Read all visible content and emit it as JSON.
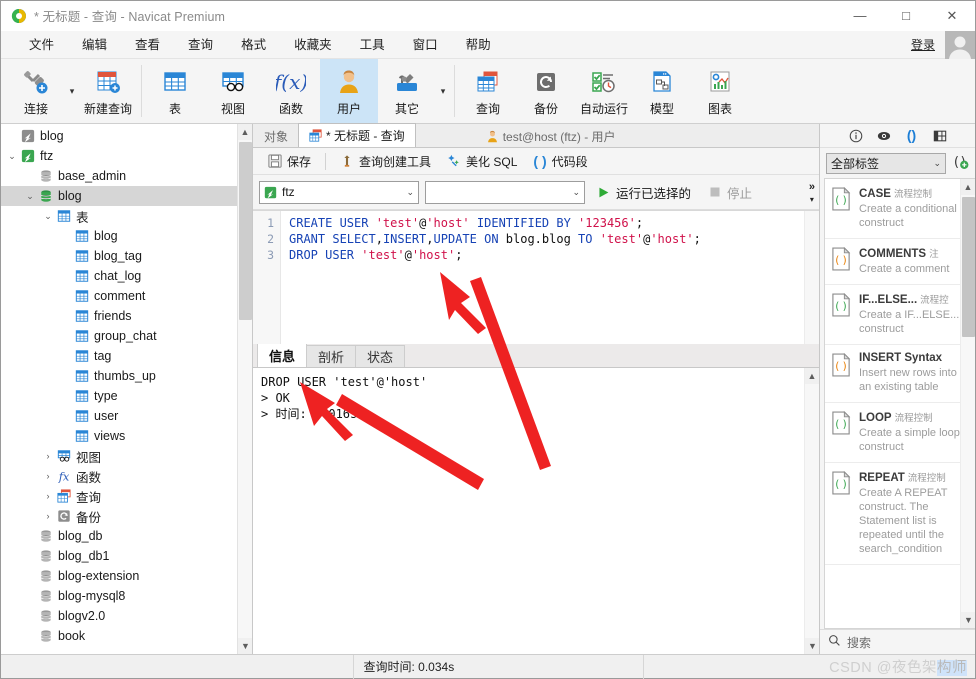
{
  "window": {
    "title_prefix": "* 无标题",
    "title_middle": "查询",
    "title_app": "Navicat Premium",
    "title_full": "* 无标题 - 查询 - Navicat Premium",
    "minimize": "—",
    "maximize": "□",
    "close": "✕"
  },
  "menubar": {
    "items": [
      {
        "label": "文件"
      },
      {
        "label": "编辑"
      },
      {
        "label": "查看"
      },
      {
        "label": "查询"
      },
      {
        "label": "格式"
      },
      {
        "label": "收藏夹"
      },
      {
        "label": "工具"
      },
      {
        "label": "窗口"
      },
      {
        "label": "帮助"
      }
    ],
    "login_label": "登录"
  },
  "ribbon": {
    "items": [
      {
        "label": "连接",
        "icon": "connection-icon",
        "has_caret": true,
        "active": false
      },
      {
        "label": "新建查询",
        "icon": "new-query-icon",
        "has_caret": false,
        "active": false
      },
      {
        "label": "表",
        "icon": "table-icon",
        "has_caret": false,
        "active": false
      },
      {
        "label": "视图",
        "icon": "view-icon",
        "has_caret": false,
        "active": false
      },
      {
        "label": "函数",
        "icon": "function-icon",
        "has_caret": false,
        "active": false
      },
      {
        "label": "用户",
        "icon": "user-icon",
        "has_caret": false,
        "active": true
      },
      {
        "label": "其它",
        "icon": "others-icon",
        "has_caret": true,
        "active": false
      },
      {
        "label": "查询",
        "icon": "query-icon",
        "has_caret": false,
        "active": false
      },
      {
        "label": "备份",
        "icon": "backup-icon",
        "has_caret": false,
        "active": false
      },
      {
        "label": "自动运行",
        "icon": "automation-icon",
        "has_caret": false,
        "active": false
      },
      {
        "label": "模型",
        "icon": "model-icon",
        "has_caret": false,
        "active": false
      },
      {
        "label": "图表",
        "icon": "chart-icon",
        "has_caret": false,
        "active": false
      }
    ]
  },
  "tree": {
    "nodes": [
      {
        "label": "blog",
        "depth": 0,
        "icon": "connection-gray-icon",
        "twist": "",
        "selected": false
      },
      {
        "label": "ftz",
        "depth": 0,
        "icon": "connection-green-icon",
        "twist": "expanded",
        "selected": false
      },
      {
        "label": "base_admin",
        "depth": 1,
        "icon": "database-gray-icon",
        "twist": "",
        "selected": false
      },
      {
        "label": "blog",
        "depth": 1,
        "icon": "database-green-icon",
        "twist": "expanded",
        "selected": true
      },
      {
        "label": "表",
        "depth": 2,
        "icon": "tables-folder-icon",
        "twist": "expanded",
        "selected": false
      },
      {
        "label": "blog",
        "depth": 3,
        "icon": "table-item-icon",
        "twist": "",
        "selected": false
      },
      {
        "label": "blog_tag",
        "depth": 3,
        "icon": "table-item-icon",
        "twist": "",
        "selected": false
      },
      {
        "label": "chat_log",
        "depth": 3,
        "icon": "table-item-icon",
        "twist": "",
        "selected": false
      },
      {
        "label": "comment",
        "depth": 3,
        "icon": "table-item-icon",
        "twist": "",
        "selected": false
      },
      {
        "label": "friends",
        "depth": 3,
        "icon": "table-item-icon",
        "twist": "",
        "selected": false
      },
      {
        "label": "group_chat",
        "depth": 3,
        "icon": "table-item-icon",
        "twist": "",
        "selected": false
      },
      {
        "label": "tag",
        "depth": 3,
        "icon": "table-item-icon",
        "twist": "",
        "selected": false
      },
      {
        "label": "thumbs_up",
        "depth": 3,
        "icon": "table-item-icon",
        "twist": "",
        "selected": false
      },
      {
        "label": "type",
        "depth": 3,
        "icon": "table-item-icon",
        "twist": "",
        "selected": false
      },
      {
        "label": "user",
        "depth": 3,
        "icon": "table-item-icon",
        "twist": "",
        "selected": false
      },
      {
        "label": "views",
        "depth": 3,
        "icon": "table-item-icon",
        "twist": "",
        "selected": false
      },
      {
        "label": "视图",
        "depth": 2,
        "icon": "views-folder-icon",
        "twist": "collapsed",
        "selected": false
      },
      {
        "label": "函数",
        "depth": 2,
        "icon": "functions-folder-icon",
        "twist": "collapsed",
        "selected": false
      },
      {
        "label": "查询",
        "depth": 2,
        "icon": "queries-folder-icon",
        "twist": "collapsed",
        "selected": false
      },
      {
        "label": "备份",
        "depth": 2,
        "icon": "backups-folder-icon",
        "twist": "collapsed",
        "selected": false
      },
      {
        "label": "blog_db",
        "depth": 1,
        "icon": "database-gray-icon",
        "twist": "",
        "selected": false
      },
      {
        "label": "blog_db1",
        "depth": 1,
        "icon": "database-gray-icon",
        "twist": "",
        "selected": false
      },
      {
        "label": "blog-extension",
        "depth": 1,
        "icon": "database-gray-icon",
        "twist": "",
        "selected": false
      },
      {
        "label": "blog-mysql8",
        "depth": 1,
        "icon": "database-gray-icon",
        "twist": "",
        "selected": false
      },
      {
        "label": "blogv2.0",
        "depth": 1,
        "icon": "database-gray-icon",
        "twist": "",
        "selected": false
      },
      {
        "label": "book",
        "depth": 1,
        "icon": "database-gray-icon",
        "twist": "",
        "selected": false
      }
    ]
  },
  "tabs": {
    "items": [
      {
        "label": "对象",
        "active": false,
        "icon": ""
      },
      {
        "label": "* 无标题 - 查询",
        "active": true,
        "icon": "query-tab-icon"
      },
      {
        "label": "test@host (ftz) - 用户",
        "active": false,
        "icon": "user-tab-icon"
      }
    ]
  },
  "query_toolbar": {
    "save_label": "保存",
    "builder_label": "查询创建工具",
    "beautify_label": "美化 SQL",
    "snippet_label": "代码段"
  },
  "query_run": {
    "connection_value": "ftz",
    "database_value": "",
    "run_selected_label": "运行已选择的",
    "stop_label": "停止",
    "overflow_label": "»"
  },
  "editor": {
    "line_numbers": [
      "1",
      "2",
      "3"
    ],
    "lines": [
      {
        "highlight": false,
        "parts": [
          {
            "t": "CREATE USER ",
            "c": "kw"
          },
          {
            "t": "'test'",
            "c": "str"
          },
          {
            "t": "@",
            "c": "pl"
          },
          {
            "t": "'host'",
            "c": "str"
          },
          {
            "t": " ",
            "c": "pl"
          },
          {
            "t": "IDENTIFIED BY ",
            "c": "kw"
          },
          {
            "t": "'123456'",
            "c": "str"
          },
          {
            "t": ";",
            "c": "pl"
          }
        ]
      },
      {
        "highlight": false,
        "parts": [
          {
            "t": "GRANT SELECT",
            "c": "kw"
          },
          {
            "t": ",",
            "c": "pl"
          },
          {
            "t": "INSERT",
            "c": "kw"
          },
          {
            "t": ",",
            "c": "pl"
          },
          {
            "t": "UPDATE ON ",
            "c": "kw"
          },
          {
            "t": "blog.blog ",
            "c": "pl"
          },
          {
            "t": "TO ",
            "c": "kw"
          },
          {
            "t": "'test'",
            "c": "str"
          },
          {
            "t": "@",
            "c": "pl"
          },
          {
            "t": "'host'",
            "c": "str"
          },
          {
            "t": ";",
            "c": "pl"
          }
        ]
      },
      {
        "highlight": true,
        "parts": [
          {
            "t": "DROP USER ",
            "c": "kw"
          },
          {
            "t": "'test'",
            "c": "str"
          },
          {
            "t": "@",
            "c": "pl"
          },
          {
            "t": "'host'",
            "c": "str"
          },
          {
            "t": ";",
            "c": "pl"
          }
        ]
      }
    ]
  },
  "results": {
    "tabs": [
      {
        "label": "信息",
        "active": true
      },
      {
        "label": "剖析",
        "active": false
      },
      {
        "label": "状态",
        "active": false
      }
    ],
    "message_lines": [
      "DROP USER 'test'@'host'",
      "> OK",
      "> 时间: 0.016s"
    ]
  },
  "right_panel": {
    "icons": [
      {
        "name": "info-icon",
        "glyph": "ⓘ",
        "active": false
      },
      {
        "name": "eye-icon",
        "glyph": "◉",
        "active": false
      },
      {
        "name": "parentheses-icon",
        "glyph": "( )",
        "active": true
      },
      {
        "name": "grid-icon",
        "glyph": "▤",
        "active": false
      }
    ],
    "filter_value": "全部标签",
    "add_snippet_label": "+",
    "search_placeholder": "搜索",
    "snippets": [
      {
        "title": "CASE",
        "category": "流程控制",
        "desc": "Create a conditional construct",
        "icon_color": "#3aa650"
      },
      {
        "title": "COMMENTS",
        "category": "注",
        "desc": "Create a comment",
        "icon_color": "#e8820c"
      },
      {
        "title": "IF...ELSE...",
        "category": "流程控",
        "desc": "Create a IF...ELSE... construct",
        "icon_color": "#3aa650"
      },
      {
        "title": "INSERT Syntax",
        "category": "",
        "desc": "Insert new rows into an existing table",
        "icon_color": "#e8820c"
      },
      {
        "title": "LOOP",
        "category": "流程控制",
        "desc": "Create a simple loop construct",
        "icon_color": "#3aa650"
      },
      {
        "title": "REPEAT",
        "category": "流程控制",
        "desc": "Create A REPEAT construct. The Statement list is repeated until the search_condition",
        "icon_color": "#3aa650"
      }
    ]
  },
  "statusbar": {
    "query_time_label": "查询时间: 0.034s",
    "watermark_plain": "CSDN @夜色架",
    "watermark_selected": "构师"
  },
  "colors": {
    "accent_blue": "#1743b5",
    "string_red": "#d0114a",
    "selection_blue": "#cfe3fa",
    "active_ribbon": "#cce4f7",
    "arrow_red": "#ee2222"
  }
}
